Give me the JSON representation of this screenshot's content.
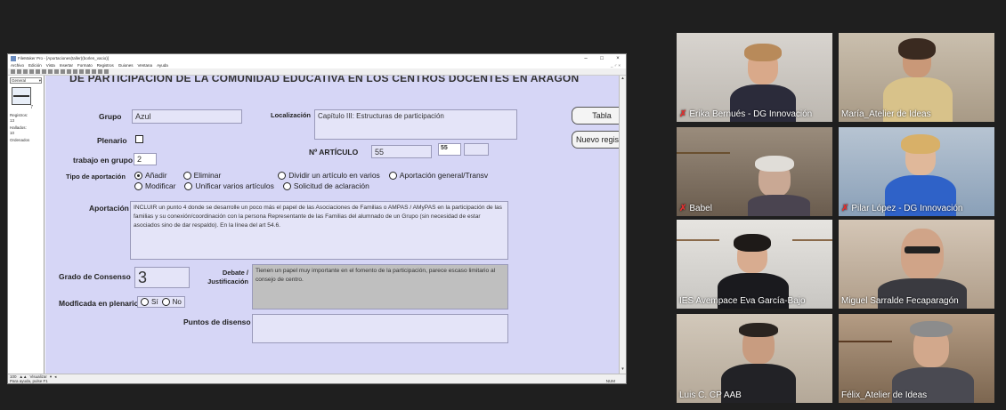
{
  "filemaker": {
    "title": "FileMaker Pro - [Aportaciones(taller)(borlen_vacio)]",
    "window_controls": [
      "–",
      "□",
      "×"
    ],
    "menu": [
      "Archivo",
      "Edición",
      "Vista",
      "Insertar",
      "Formato",
      "Registros",
      "Guiones",
      "Ventana",
      "Ayuda"
    ],
    "mdi_controls": "_ ♂ ×",
    "left_panel": {
      "layout": "General",
      "record_number": "7",
      "registros_label": "Registros:",
      "registros_value": "13",
      "hallados_label": "Hallados:",
      "hallados_value": "10",
      "ordenados_label": "Ordenados"
    },
    "status": {
      "zoom": "100",
      "mode": "Visualizar",
      "help": "Para ayuda, pulse F1",
      "num": "NUM"
    },
    "form": {
      "heading": "DE PARTICIPACIÓN DE LA COMUNIDAD EDUCATIVA EN LOS CENTROS DOCENTES EN ARAGÓN",
      "grupo_label": "Grupo",
      "grupo_value": "Azul",
      "localizacion_label": "Localización",
      "localizacion_value": "Capítulo III: Estructuras de participación",
      "plenario_label": "Plenario",
      "trabajo_label": "trabajo en grupo",
      "trabajo_value": "2",
      "articulo_label": "Nº ARTÍCULO",
      "articulo_value": "55",
      "articulo_box": "55",
      "tipo_label": "Tipo de aportación",
      "tipo_options_row1": [
        "Añadir",
        "Eliminar",
        "Dividir un artículo  en varios",
        "Aportación general/Transv"
      ],
      "tipo_options_row2": [
        "Modificar",
        "Unificar varios artículos",
        "Solicitud de aclaración"
      ],
      "tipo_selected": "Añadir",
      "aportacion_label": "Aportación",
      "aportacion_value": "INCLUIR un punto 4 donde se desarrolle un poco más el papel de las Asociaciones de Familias o AMPAS / AMyPAS en la participación de las familias y su conexión/coordinación con la persona Representante de las Familias del alumnado de un Grupo (sin necesidad de estar asociados sino de dar respaldo). En la línea del art 54.6.",
      "consenso_label": "Grado de Consenso",
      "consenso_value": "3",
      "debate_label1": "Debate /",
      "debate_label2": "Justificación",
      "debate_value": "Tienen un papel muy importante en el fomento de la participación, parece escaso limitario al consejo de centro.",
      "modificada_label": "Modficada en plenario",
      "modificada_options": [
        "Sí",
        "No"
      ],
      "disenso_label": "Puntos de disenso",
      "btn_tabla": "Tabla",
      "btn_nuevo": "Nuevo registro"
    }
  },
  "participants": [
    {
      "name": "Erika Bernués - DG Innovación",
      "muted": true
    },
    {
      "name": "María_Atelier de Ideas",
      "muted": false
    },
    {
      "name": "Babel",
      "muted": true
    },
    {
      "name": "Pilar López - DG Innovación",
      "muted": true
    },
    {
      "name": "IES Avempace Eva García-Bajo",
      "muted": false
    },
    {
      "name": "Miguel Sarralde Fecaparagón",
      "muted": false,
      "active": true
    },
    {
      "name": "Luis C. CP AAB",
      "muted": false
    },
    {
      "name": "Félix_Atelier de Ideas",
      "muted": false
    }
  ],
  "colors": {
    "form_background": "#d6d6f6",
    "active_speaker": "#c8d84a",
    "muted_icon": "#e03030"
  },
  "icons": {
    "muted": "microphone-muted-icon",
    "app": "filemaker-app-icon"
  }
}
